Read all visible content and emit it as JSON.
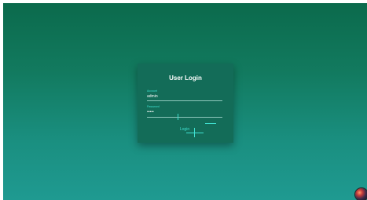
{
  "login": {
    "title": "User Login",
    "account_label": "Account",
    "account_value": "admin",
    "password_label": "Password",
    "password_value": "•••••",
    "login_label": "Login"
  }
}
